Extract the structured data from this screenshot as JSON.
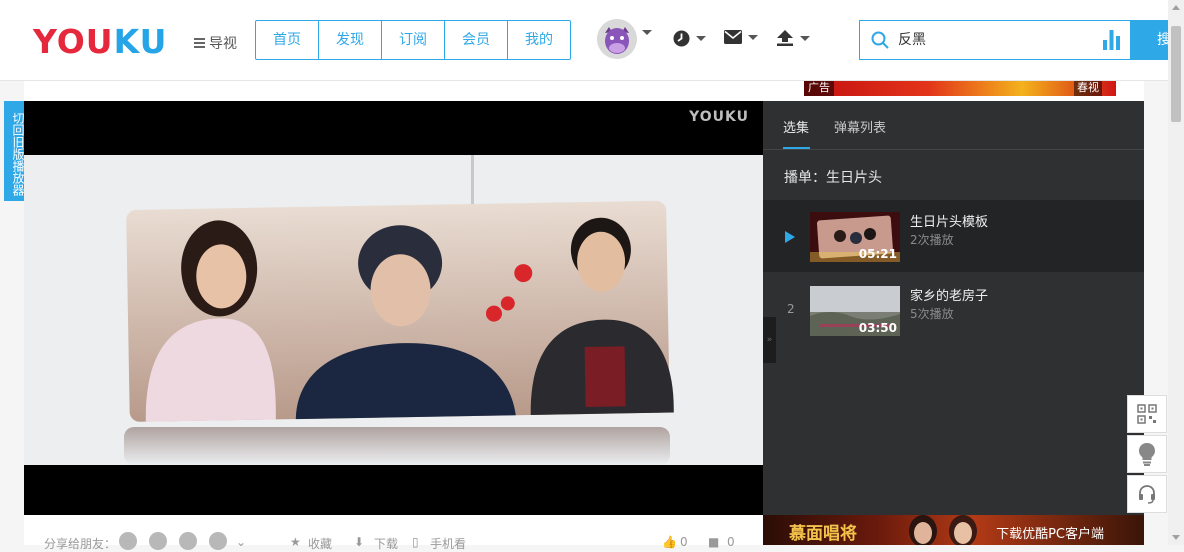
{
  "header": {
    "logo_text_part1": "YOU",
    "logo_text_part2": "KU",
    "guide_label": "导视",
    "nav": [
      "首页",
      "发现",
      "订阅",
      "会员",
      "我的"
    ],
    "search_value": "反黑",
    "search_button": "搜"
  },
  "left_tab": {
    "label": "切回旧版播放器"
  },
  "player": {
    "watermark": "YOUKU"
  },
  "ad_strip": {
    "tag": "广告",
    "tag_right": "春视"
  },
  "sidebar": {
    "tabs": [
      "选集",
      "弹幕列表"
    ],
    "playlist_title": "播单：生日片头",
    "items": [
      {
        "num": "",
        "title": "生日片头模板",
        "views": "2次播放",
        "duration": "05:21",
        "current": true
      },
      {
        "num": "2",
        "title": "家乡的老房子",
        "views": "5次播放",
        "duration": "03:50",
        "current": false
      }
    ],
    "collapse_glyph": "»"
  },
  "bottom": {
    "share_label": "分享给朋友：",
    "fav_label": "收藏",
    "download_label": "下载",
    "phone_label": "手机看",
    "like_count": "0",
    "comment_count": "0"
  },
  "bottom_ad": {
    "left_text": "慕面唱将",
    "right_text": "下载优酷PC客户端"
  },
  "colors": {
    "brand_blue": "#2fa8e8",
    "brand_red": "#e5283c",
    "sidebar_bg": "#2f3031"
  }
}
